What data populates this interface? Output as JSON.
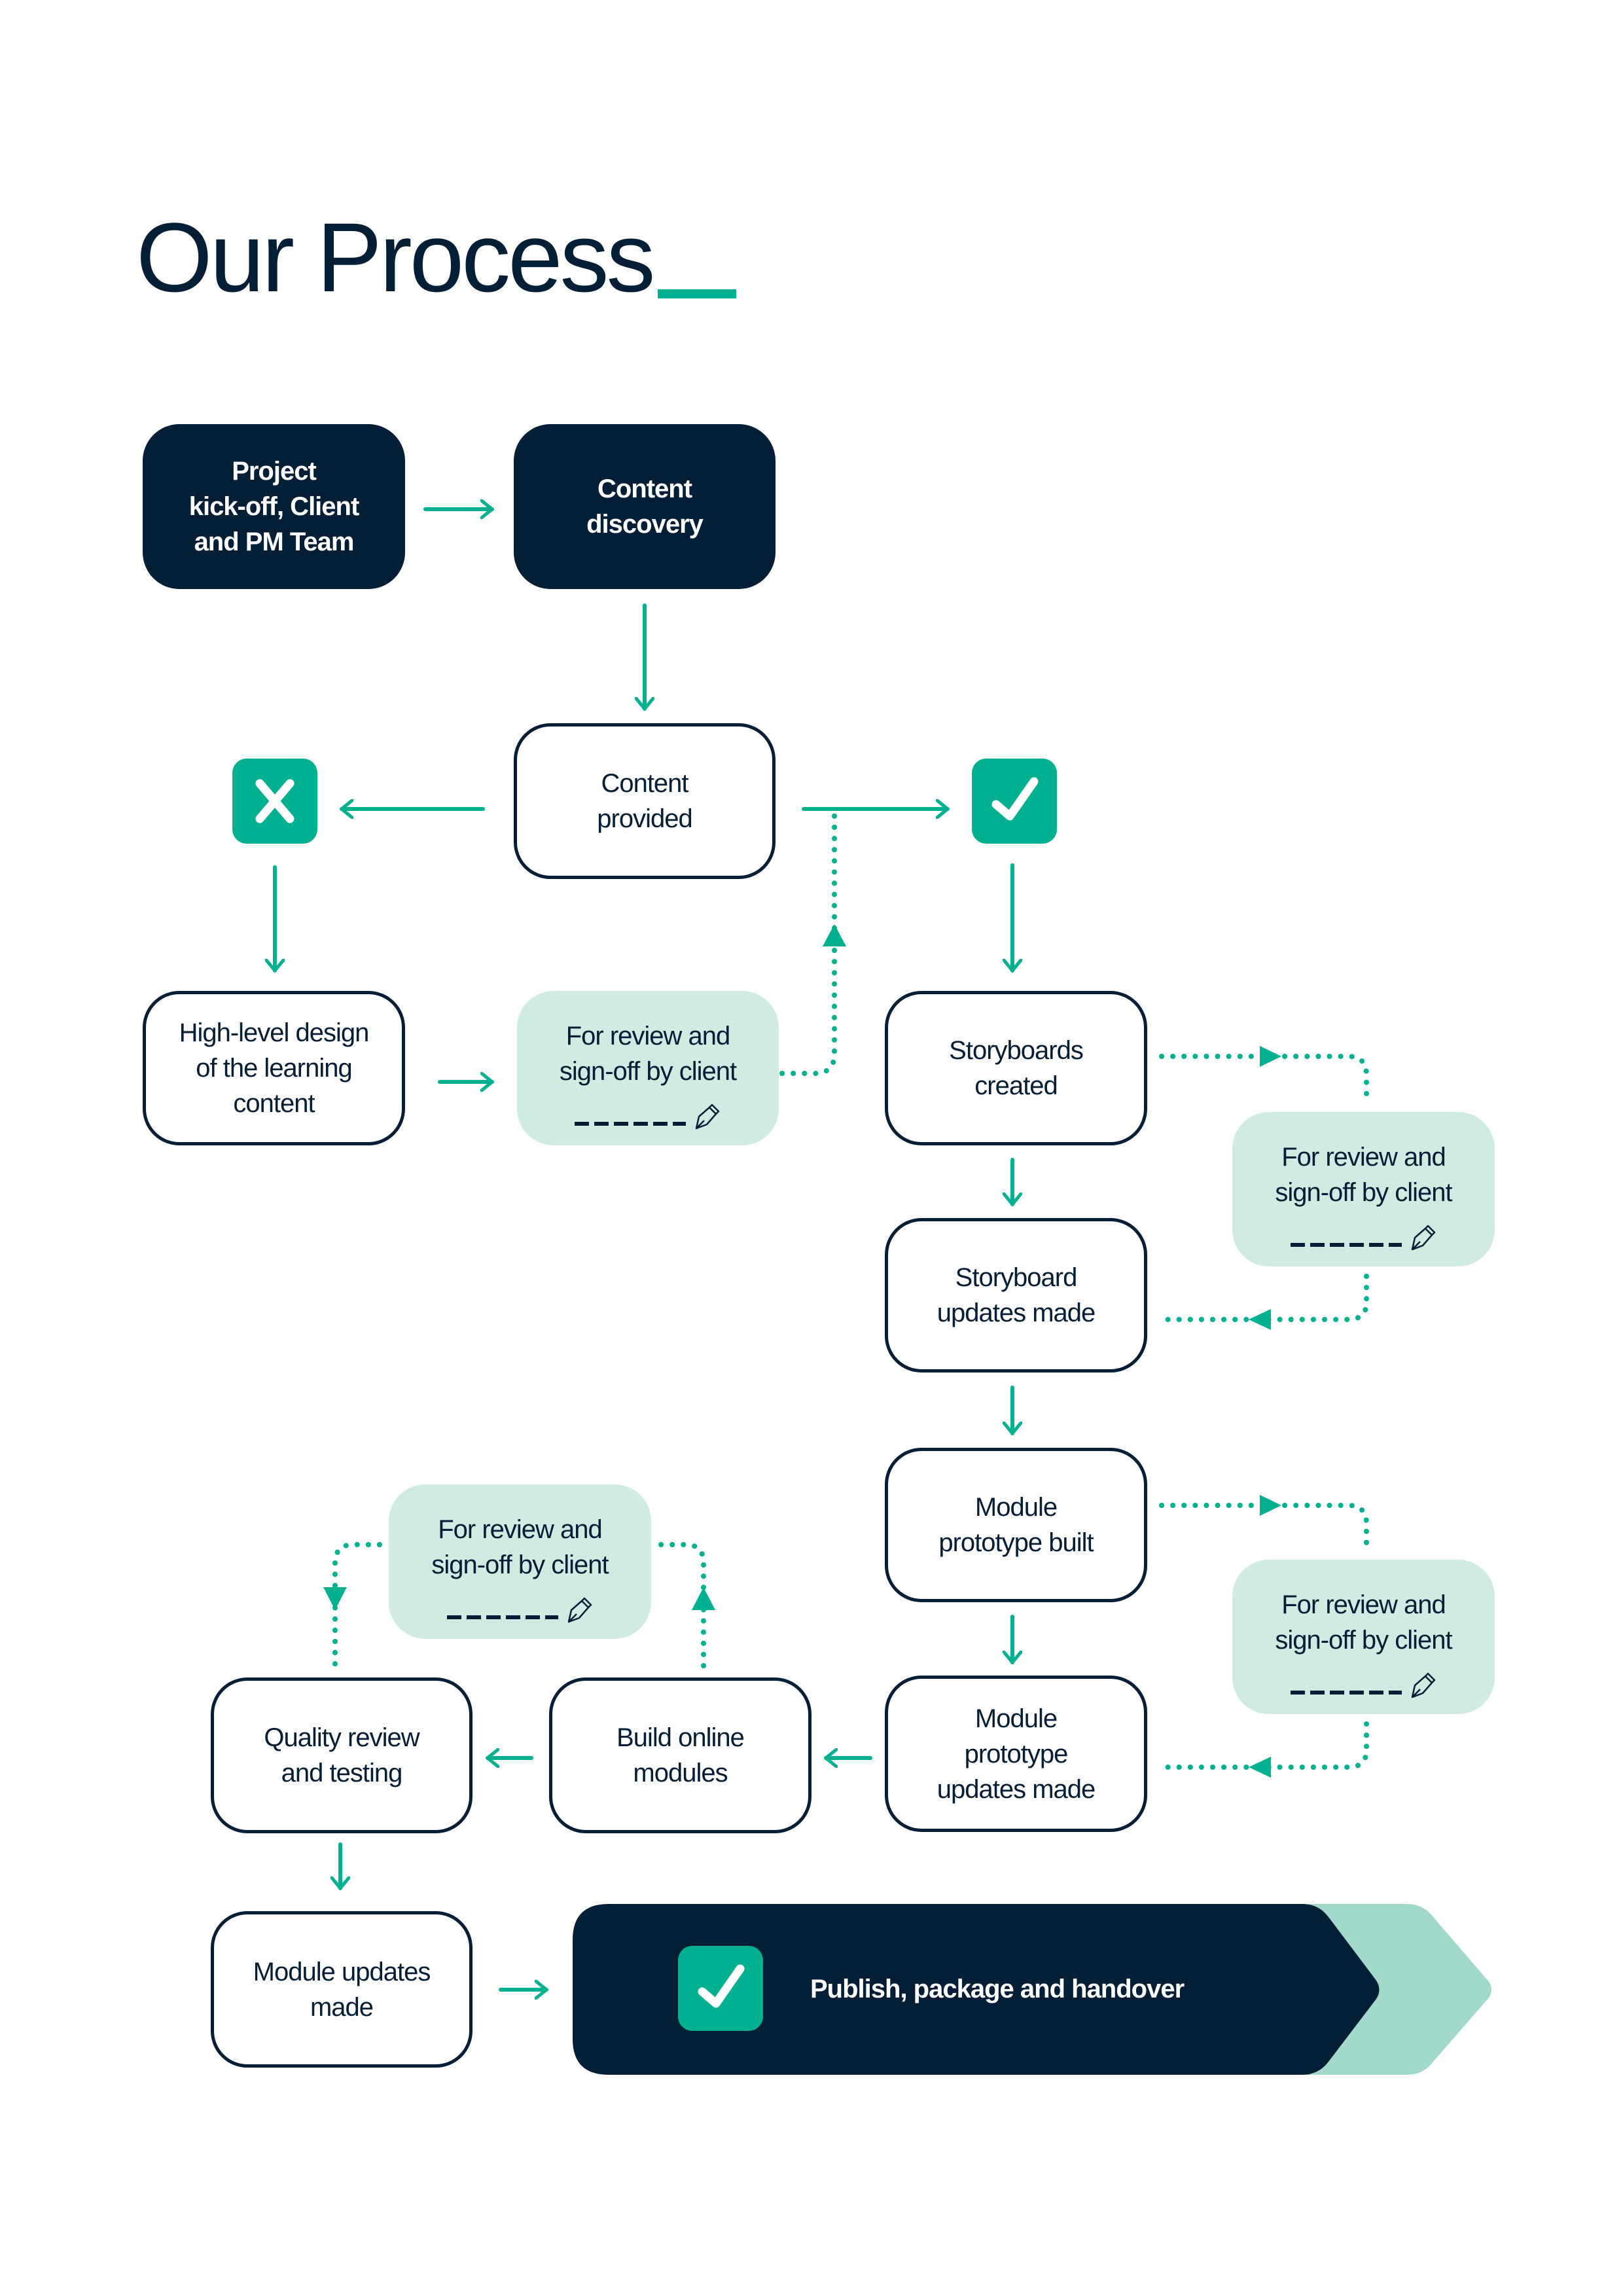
{
  "page": {
    "title": "Our Process",
    "accent_color": "#00b08e",
    "dark_color": "#041e35",
    "review_fill": "#d0ebe2",
    "banner_tail_fill": "#a3d9cb"
  },
  "nodes": {
    "kickoff": {
      "line1": "Project",
      "line2": "kick-off, Client",
      "line3": "and PM Team"
    },
    "discovery": {
      "line1": "Content",
      "line2": "discovery"
    },
    "provided": {
      "line1": "Content",
      "line2": "provided"
    },
    "reject_icon": "x-icon",
    "approve_icon": "check-icon",
    "highlevel": {
      "line1": "High-level design",
      "line2": "of the learning",
      "line3": "content"
    },
    "storyboards_created": {
      "line1": "Storyboards",
      "line2": "created"
    },
    "storyboard_updates": {
      "line1": "Storyboard",
      "line2": "updates made"
    },
    "prototype_built": {
      "line1": "Module",
      "line2": "prototype built"
    },
    "prototype_updates": {
      "line1": "Module",
      "line2": "prototype",
      "line3": "updates made"
    },
    "build_online": {
      "line1": "Build online",
      "line2": "modules"
    },
    "quality_review": {
      "line1": "Quality review",
      "line2": "and testing"
    },
    "module_updates": {
      "line1": "Module updates",
      "line2": "made"
    }
  },
  "review": {
    "line1": "For review and",
    "line2": "sign-off by client",
    "icon": "pen-nib-icon"
  },
  "banner": {
    "label": "Publish, package and handover",
    "icon": "check-icon"
  }
}
